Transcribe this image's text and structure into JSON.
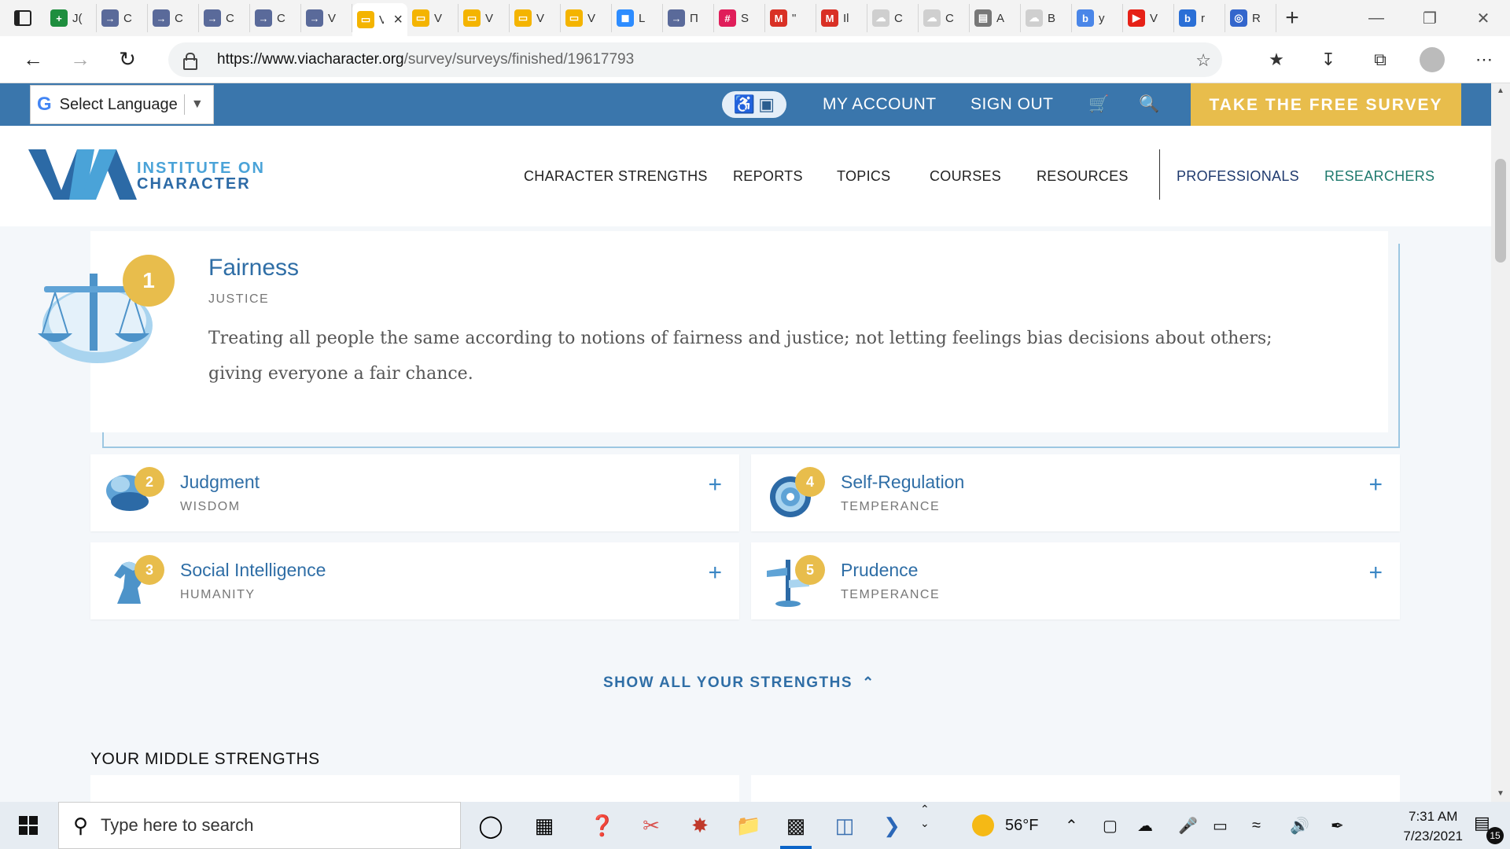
{
  "browser": {
    "tabs": [
      {
        "title": "J(",
        "icon": "sheets-icon",
        "color": "#1e8e3e"
      },
      {
        "title": "C",
        "icon": "arrow-icon",
        "color": "#5a6a9a"
      },
      {
        "title": "C",
        "icon": "arrow-icon",
        "color": "#5a6a9a"
      },
      {
        "title": "C",
        "icon": "arrow-icon",
        "color": "#5a6a9a"
      },
      {
        "title": "C",
        "icon": "arrow-icon",
        "color": "#5a6a9a"
      },
      {
        "title": "V",
        "icon": "arrow-icon",
        "color": "#5a6a9a"
      },
      {
        "title": "V",
        "icon": "slides-icon",
        "color": "#f4b400",
        "active": true
      },
      {
        "title": "V",
        "icon": "slides-icon",
        "color": "#f4b400"
      },
      {
        "title": "V",
        "icon": "slides-icon",
        "color": "#f4b400"
      },
      {
        "title": "V",
        "icon": "slides-icon",
        "color": "#f4b400"
      },
      {
        "title": "V",
        "icon": "slides-icon",
        "color": "#f4b400"
      },
      {
        "title": "L",
        "icon": "zoom-icon",
        "color": "#2d8cff"
      },
      {
        "title": "Π",
        "icon": "arrow-icon",
        "color": "#5a6a9a"
      },
      {
        "title": "S",
        "icon": "slack-icon",
        "color": "#e01e5a"
      },
      {
        "title": "\"",
        "icon": "gmail-icon",
        "color": "#d93025"
      },
      {
        "title": "Il",
        "icon": "gmail-icon",
        "color": "#d93025"
      },
      {
        "title": "C",
        "icon": "cloud-icon",
        "color": "#cfcfcf"
      },
      {
        "title": "C",
        "icon": "cloud-icon",
        "color": "#cfcfcf"
      },
      {
        "title": "A",
        "icon": "doc-icon",
        "color": "#777777"
      },
      {
        "title": "B",
        "icon": "cloud-icon",
        "color": "#cfcfcf"
      },
      {
        "title": "y",
        "icon": "bing-icon",
        "color": "#4a86e8"
      },
      {
        "title": "V",
        "icon": "youtube-icon",
        "color": "#e62117"
      },
      {
        "title": "r",
        "icon": "bing-icon",
        "color": "#2a6fd6"
      },
      {
        "title": "R",
        "icon": "chrome-icon",
        "color": "#3366cc"
      }
    ],
    "active_tab_title": "V",
    "url_host": "https://www.viacharacter.org",
    "url_path": "/survey/surveys/finished/19617793"
  },
  "site": {
    "language_label": "Select Language",
    "my_account": "MY ACCOUNT",
    "sign_out": "SIGN OUT",
    "cta": "TAKE THE FREE SURVEY",
    "logo_line1": "INSTITUTE ON",
    "logo_line2": "CHARACTER",
    "nav": [
      {
        "label": "CHARACTER STRENGTHS",
        "color": "#222222"
      },
      {
        "label": "REPORTS",
        "color": "#222222"
      },
      {
        "label": "TOPICS",
        "color": "#222222"
      },
      {
        "label": "COURSES",
        "color": "#222222"
      },
      {
        "label": "RESOURCES",
        "color": "#222222"
      },
      {
        "label": "PROFESSIONALS",
        "color": "#1f3a6e"
      },
      {
        "label": "RESEARCHERS",
        "color": "#1f7a6e"
      }
    ],
    "colors": {
      "brand_blue": "#3a76ac",
      "gold": "#e8bd4c",
      "title_blue": "#2f6ea6"
    }
  },
  "top_strength": {
    "rank": "1",
    "name": "Fairness",
    "virtue": "JUSTICE",
    "description": "Treating all people the same according to notions of fairness and justice; not letting feelings bias decisions about others; giving everyone a fair chance."
  },
  "strengths": [
    {
      "rank": "2",
      "name": "Judgment",
      "virtue": "WISDOM",
      "icon": "brain-icon"
    },
    {
      "rank": "4",
      "name": "Self-Regulation",
      "virtue": "TEMPERANCE",
      "icon": "target-icon"
    },
    {
      "rank": "3",
      "name": "Social Intelligence",
      "virtue": "HUMANITY",
      "icon": "chess-knight-icon"
    },
    {
      "rank": "5",
      "name": "Prudence",
      "virtue": "TEMPERANCE",
      "icon": "signpost-icon"
    }
  ],
  "show_all_label": "SHOW ALL YOUR STRENGTHS",
  "middle_heading": "YOUR MIDDLE STRENGTHS",
  "taskbar": {
    "search_placeholder": "Type here to search",
    "weather": "56°F",
    "time": "7:31 AM",
    "date": "7/23/2021",
    "notifications": "15"
  }
}
